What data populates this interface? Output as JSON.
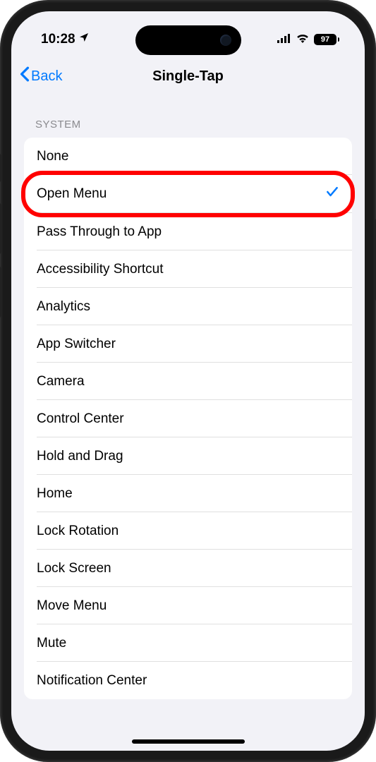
{
  "status": {
    "time": "10:28",
    "battery": "97"
  },
  "nav": {
    "back": "Back",
    "title": "Single-Tap"
  },
  "section": {
    "header": "SYSTEM"
  },
  "options": [
    {
      "label": "None",
      "selected": false
    },
    {
      "label": "Open Menu",
      "selected": true
    },
    {
      "label": "Pass Through to App",
      "selected": false
    },
    {
      "label": "Accessibility Shortcut",
      "selected": false
    },
    {
      "label": "Analytics",
      "selected": false
    },
    {
      "label": "App Switcher",
      "selected": false
    },
    {
      "label": "Camera",
      "selected": false
    },
    {
      "label": "Control Center",
      "selected": false
    },
    {
      "label": "Hold and Drag",
      "selected": false
    },
    {
      "label": "Home",
      "selected": false
    },
    {
      "label": "Lock Rotation",
      "selected": false
    },
    {
      "label": "Lock Screen",
      "selected": false
    },
    {
      "label": "Move Menu",
      "selected": false
    },
    {
      "label": "Mute",
      "selected": false
    },
    {
      "label": "Notification Center",
      "selected": false
    }
  ],
  "highlight_index": 1
}
